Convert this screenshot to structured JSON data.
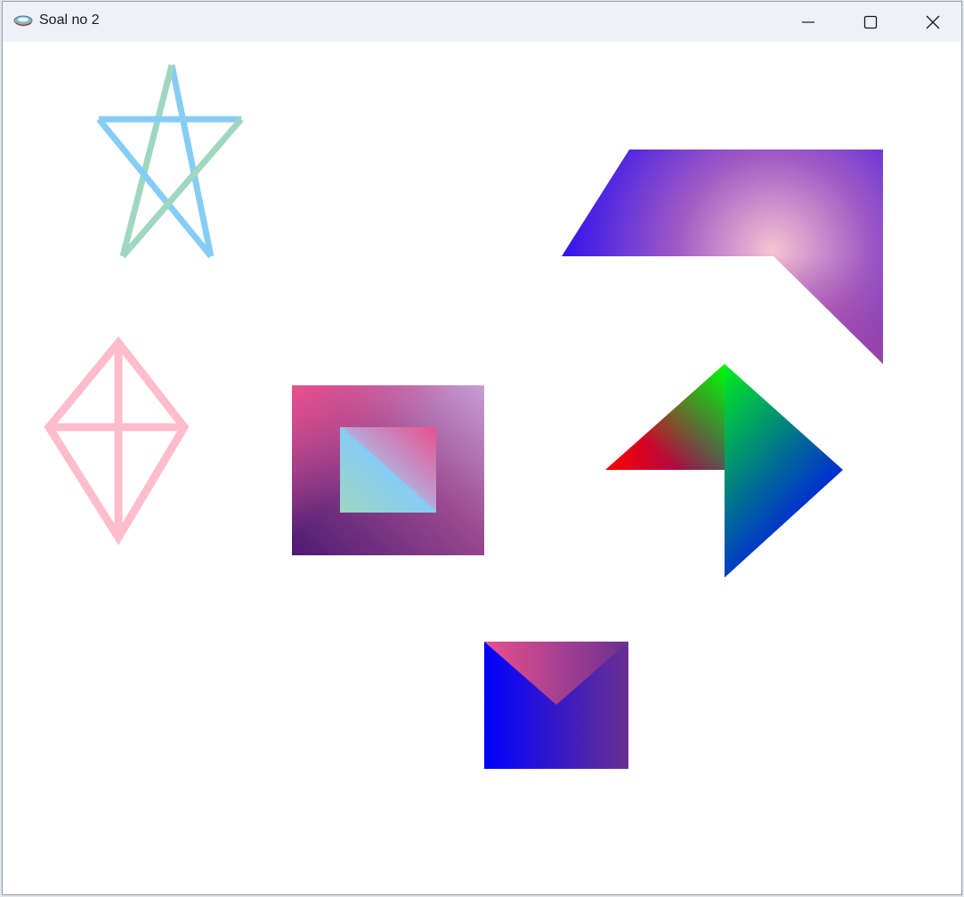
{
  "window": {
    "title": "Soal no 2",
    "app_icon": "java-cup-icon",
    "controls": {
      "minimize_icon": "minimize-icon",
      "maximize_icon": "maximize-icon",
      "close_icon": "close-icon"
    }
  },
  "colors": {
    "titlebar_bg": "#eef2f8",
    "canvas_bg": "#ffffff",
    "star_line_blue": "#86cdf5",
    "star_line_green": "#9fd6c0",
    "kite_pink": "#ffbccb",
    "square_pink": "#e9508f",
    "square_lilac": "#c79ed6",
    "square_purple": "#4d1a72",
    "inner_square_pink": "#ea4f8d",
    "inner_square_teal": "#9fd6c0",
    "inner_square_blue": "#86cdf5",
    "banner_blue": "#0000ff",
    "banner_light_pink": "#f5b3c9",
    "banner_purple": "#a046a0",
    "arrow_red": "#ff0000",
    "arrow_green": "#00ff00",
    "arrow_blue": "#0000ff",
    "arrow_purple": "#7a1070",
    "envelope_blue": "#0000ff",
    "envelope_purple": "#6a3090",
    "envelope_pink": "#e9508f"
  },
  "shapes": [
    {
      "name": "star",
      "icon": "star-outline"
    },
    {
      "name": "kite",
      "icon": "kite-outline"
    },
    {
      "name": "gradient-square",
      "icon": "nested-square"
    },
    {
      "name": "gradient-banner",
      "icon": "pentagon-banner"
    },
    {
      "name": "gradient-arrow",
      "icon": "rgb-arrow"
    },
    {
      "name": "gradient-envelope",
      "icon": "envelope"
    }
  ]
}
